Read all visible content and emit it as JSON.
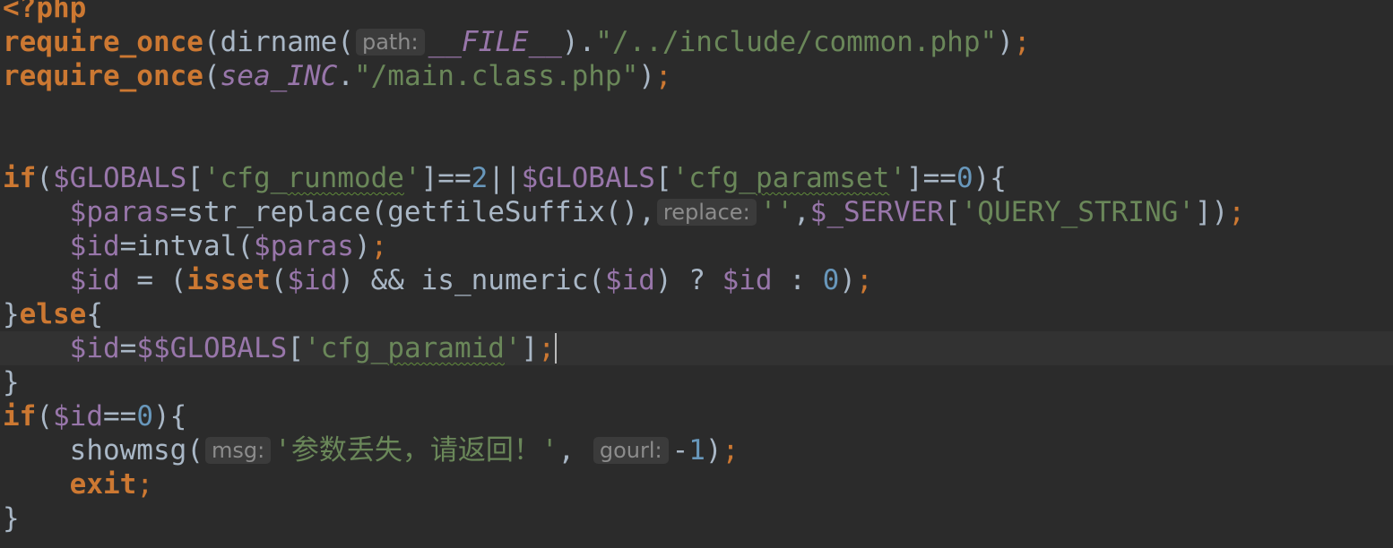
{
  "lines": [
    {
      "t": [
        [
          "kw",
          "<?php"
        ]
      ]
    },
    {
      "t": [
        [
          "kw",
          "require_once"
        ],
        [
          "op",
          "(dirname("
        ],
        [
          "hint",
          "path:"
        ],
        [
          "cst",
          "__FILE__"
        ],
        [
          "op",
          ")."
        ],
        [
          "str",
          "\"/../include/common.php\""
        ],
        [
          "op",
          ")"
        ],
        [
          "semi",
          ";"
        ]
      ]
    },
    {
      "t": [
        [
          "kw",
          "require_once"
        ],
        [
          "op",
          "("
        ],
        [
          "cst",
          "sea_INC"
        ],
        [
          "op",
          "."
        ],
        [
          "str",
          "\"/main.class.php\""
        ],
        [
          "op",
          ")"
        ],
        [
          "semi",
          ";"
        ]
      ]
    },
    {
      "t": []
    },
    {
      "t": []
    },
    {
      "t": [
        [
          "kw",
          "if"
        ],
        [
          "op",
          "("
        ],
        [
          "var",
          "$GLOBALS"
        ],
        [
          "op",
          "["
        ],
        [
          "str",
          "'cfg_"
        ],
        [
          "strsq",
          "runmode"
        ],
        [
          "str",
          "'"
        ],
        [
          "op",
          "]=="
        ],
        [
          "num",
          "2"
        ],
        [
          "op",
          "||"
        ],
        [
          "var",
          "$GLOBALS"
        ],
        [
          "op",
          "["
        ],
        [
          "str",
          "'cfg_"
        ],
        [
          "strsq",
          "paramset"
        ],
        [
          "str",
          "'"
        ],
        [
          "op",
          "]=="
        ],
        [
          "num",
          "0"
        ],
        [
          "op",
          "){"
        ]
      ]
    },
    {
      "t": [
        [
          "op",
          "    "
        ],
        [
          "var",
          "$paras"
        ],
        [
          "op",
          "=str_replace(getfileSuffix(),"
        ],
        [
          "hint",
          "replace:"
        ],
        [
          "str",
          "''"
        ],
        [
          "op",
          ","
        ],
        [
          "var",
          "$_SERVER"
        ],
        [
          "op",
          "["
        ],
        [
          "str",
          "'QUERY_STRING'"
        ],
        [
          "op",
          "])"
        ],
        [
          "semi",
          ";"
        ]
      ]
    },
    {
      "t": [
        [
          "op",
          "    "
        ],
        [
          "var",
          "$id"
        ],
        [
          "op",
          "=intval("
        ],
        [
          "var",
          "$paras"
        ],
        [
          "op",
          ")"
        ],
        [
          "semi",
          ";"
        ]
      ]
    },
    {
      "t": [
        [
          "op",
          "    "
        ],
        [
          "var",
          "$id"
        ],
        [
          "op",
          " = ("
        ],
        [
          "kw",
          "isset"
        ],
        [
          "op",
          "("
        ],
        [
          "var",
          "$id"
        ],
        [
          "op",
          ") && is_numeric("
        ],
        [
          "var",
          "$id"
        ],
        [
          "op",
          ") ? "
        ],
        [
          "var",
          "$id"
        ],
        [
          "op",
          " : "
        ],
        [
          "num",
          "0"
        ],
        [
          "op",
          ")"
        ],
        [
          "semi",
          ";"
        ]
      ]
    },
    {
      "t": [
        [
          "op",
          "}"
        ],
        [
          "kw",
          "else"
        ],
        [
          "op",
          "{"
        ]
      ]
    },
    {
      "t": [
        [
          "op",
          "    "
        ],
        [
          "var",
          "$id"
        ],
        [
          "op",
          "="
        ],
        [
          "var",
          "$$GLOBALS"
        ],
        [
          "op",
          "["
        ],
        [
          "str",
          "'cfg_"
        ],
        [
          "strsq",
          "paramid"
        ],
        [
          "str",
          "'"
        ],
        [
          "op",
          "]"
        ],
        [
          "semi",
          ";"
        ],
        [
          "caret",
          ""
        ]
      ],
      "current": true
    },
    {
      "t": [
        [
          "op",
          "}"
        ]
      ]
    },
    {
      "t": [
        [
          "kw",
          "if"
        ],
        [
          "op",
          "("
        ],
        [
          "var",
          "$id"
        ],
        [
          "op",
          "=="
        ],
        [
          "num",
          "0"
        ],
        [
          "op",
          "){"
        ]
      ]
    },
    {
      "t": [
        [
          "op",
          "    showmsg("
        ],
        [
          "hint",
          "msg:"
        ],
        [
          "str",
          "'参数丢失，请返回！'"
        ],
        [
          "op",
          ", "
        ],
        [
          "hint",
          "gourl:"
        ],
        [
          "op",
          "-"
        ],
        [
          "num",
          "1"
        ],
        [
          "op",
          ")"
        ],
        [
          "semi",
          ";"
        ]
      ]
    },
    {
      "t": [
        [
          "op",
          "    "
        ],
        [
          "kw",
          "exit"
        ],
        [
          "semi",
          ";"
        ]
      ]
    },
    {
      "t": [
        [
          "op",
          "}"
        ]
      ]
    }
  ],
  "colors": {
    "background": "#2b2b2b",
    "keyword": "#cc7832",
    "variable": "#9876aa",
    "string": "#6a8759",
    "number": "#6897bb",
    "text": "#a9b7c6",
    "current_line": "#323232"
  }
}
